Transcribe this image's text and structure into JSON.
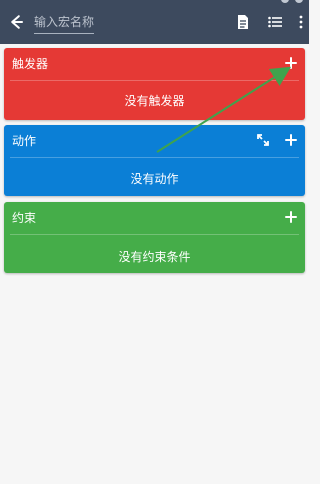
{
  "app_bar": {
    "title_placeholder": "输入宏名称",
    "icons": [
      "back-arrow-icon",
      "document-icon",
      "list-icon",
      "more-vert-icon"
    ],
    "color": "#3d4a5e"
  },
  "sections": {
    "triggers": {
      "label": "触发器",
      "empty_text": "没有触发器",
      "color": "#e53935"
    },
    "actions": {
      "label": "动作",
      "empty_text": "没有动作",
      "color": "#0b7fd6"
    },
    "constraints": {
      "label": "约束",
      "empty_text": "没有约束条件",
      "color": "#45ad49"
    }
  },
  "annotation": {
    "color": "#3fa34d"
  }
}
